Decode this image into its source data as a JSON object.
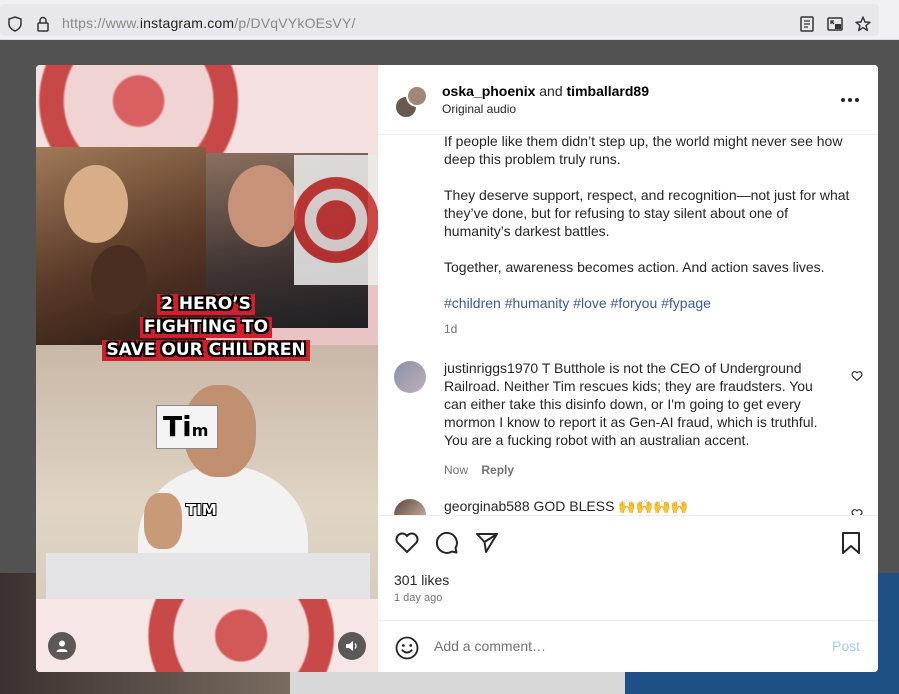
{
  "browser": {
    "url_prefix": "https://www.",
    "url_domain": "instagram.com",
    "url_path": "/p/DVqVYkOEsVY/"
  },
  "post": {
    "author1": "oska_phoenix",
    "and": "and",
    "author2": "timballard89",
    "audio": "Original audio",
    "media": {
      "caption_lines": [
        "2 HERO’S",
        "FIGHTING TO",
        "SAVE OUR CHILDREN"
      ],
      "name_tag_big": "Ti",
      "name_tag_small": "m",
      "name_label": "TIM"
    },
    "caption": {
      "p1": "If people like them didn’t step up, the world might never see how deep this problem truly runs.",
      "p2": "They deserve support, respect, and recognition—not just for what they’ve done, but for refusing to stay silent about one of humanity’s darkest battles.",
      "p3": "Together, awareness becomes action. And action saves lives.",
      "hashtags": "#children #humanity #love #foryou #fypage",
      "age": "1d"
    },
    "comments": [
      {
        "user": "justinriggs1970",
        "text": "T Butthole is not the CEO of Underground Railroad. Neither Tim rescues kids; they are fraudsters. You can either take this disinfo down, or I'm going to get every mormon I know to report it as Gen-AI fraud, which is truthful. You are a fucking robot with an australian accent.",
        "time": "Now",
        "reply": "Reply"
      },
      {
        "user": "georginab588",
        "text": "GOD BLESS 🙌🙌🙌🙌"
      }
    ],
    "likes": "301 likes",
    "posted": "1 day ago",
    "comment_placeholder": "Add a comment…",
    "post_label": "Post"
  },
  "icons": {
    "shield": "shield-icon",
    "lock": "lock-icon",
    "reader": "reader-mode-icon",
    "pip": "picture-in-picture-icon",
    "star": "star-icon",
    "more": "more-options-icon",
    "like": "heart-icon",
    "comment": "comment-icon",
    "share": "share-icon",
    "save": "bookmark-icon",
    "emoji": "emoji-icon",
    "user": "user-tag-icon",
    "sound": "speaker-icon"
  },
  "colors": {
    "link": "#3d5a99",
    "post_disabled": "#a9c9f4",
    "caption_bg": "#d21f2b"
  }
}
